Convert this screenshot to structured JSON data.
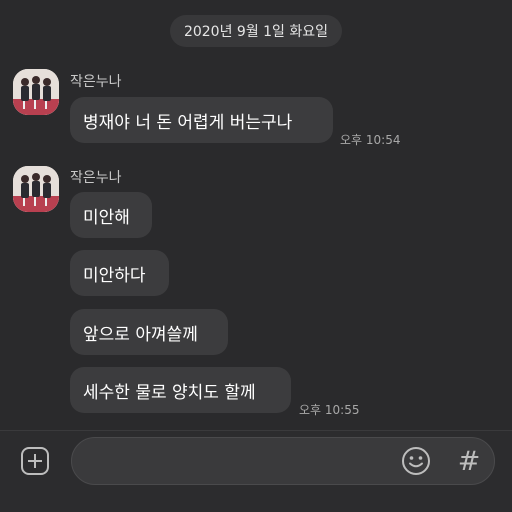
{
  "date_divider": "2020년 9월 1일 화요일",
  "groups": [
    {
      "sender": "작은누나",
      "messages": [
        "병재야 너 돈 어렵게 버는구나"
      ],
      "time": "오후 10:54"
    },
    {
      "sender": "작은누나",
      "messages": [
        "미안해",
        "미안하다",
        "앞으로 아껴쓸께",
        "세수한 물로 양치도 할께"
      ],
      "time": "오후 10:55"
    }
  ],
  "input": {
    "value": "",
    "placeholder": ""
  },
  "icons": {
    "add": "plus-square-icon",
    "emoji": "smiley-icon",
    "hashtag": "hash-icon"
  },
  "hash_symbol": "#",
  "colors": {
    "background": "#2a2a2c",
    "bubble": "#3c3c3e",
    "date_pill": "#38383a"
  }
}
